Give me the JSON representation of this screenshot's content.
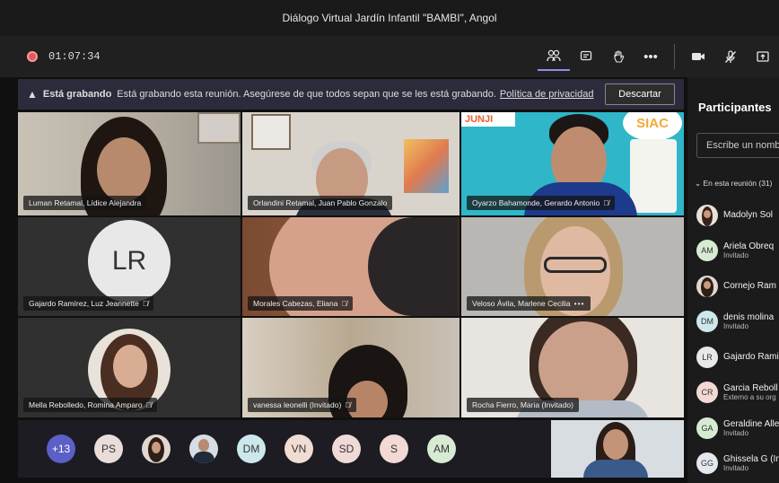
{
  "window": {
    "title": "Diálogo Virtual Jardín Infantil \"BAMBI\", Angol"
  },
  "toolbar": {
    "timer": "01:07:34",
    "icons": [
      "people-icon",
      "chat-icon",
      "raise-hand-icon",
      "more-icon",
      "camera-icon",
      "mic-off-icon",
      "share-icon"
    ]
  },
  "banner": {
    "bold": "Está grabando",
    "text": "Está grabando esta reunión. Asegúrese de que todos sepan que se les está grabando.",
    "link": "Política de privacidad",
    "button": "Descartar"
  },
  "tiles": [
    {
      "name": "Luman Retamal, Lídice Alejandra"
    },
    {
      "name": "Orlandini Retamal, Juan Pablo Gonzalo"
    },
    {
      "name": "Oyarzo Bahamonde, Gerardo Antonio",
      "sign_junji": "JUNJI",
      "sign_siac": "SIAC"
    },
    {
      "name": "Gajardo Ramírez, Luz Jeannette",
      "initials": "LR"
    },
    {
      "name": "Morales Cabezas, Eliana"
    },
    {
      "name": "Veloso Ávila, Marlene Cecilia"
    },
    {
      "name": "Mella Rebolledo, Romina Amparo"
    },
    {
      "name": "vanessa leonelli (Invitado)"
    },
    {
      "name": "Rocha Fierro, Maria (Invitado)"
    }
  ],
  "bottom_bar": {
    "more_count": "+13",
    "avatars": [
      "PS",
      "DM",
      "VN",
      "SD",
      "S",
      "AM"
    ]
  },
  "participants_panel": {
    "title": "Participantes",
    "search_placeholder": "Escribe un nomb",
    "section": "En esta reunión (31)",
    "list": [
      {
        "name": "Madolyn Sol",
        "sub": ""
      },
      {
        "name": "Ariela Obreq",
        "sub": "Invitado",
        "initials": "AM"
      },
      {
        "name": "Cornejo Ram",
        "sub": ""
      },
      {
        "name": "denis molina",
        "sub": "Invitado",
        "initials": "DM"
      },
      {
        "name": "Gajardo Rami",
        "sub": "",
        "initials": "LR"
      },
      {
        "name": "Garcia Reboll",
        "sub": "Externo a su org",
        "initials": "CR"
      },
      {
        "name": "Geraldine Alle",
        "sub": "Invitado",
        "initials": "GA"
      },
      {
        "name": "Ghissela G (In",
        "sub": "Invitado",
        "initials": "GG"
      }
    ]
  },
  "colors": {
    "accent": "#8b8df0",
    "more_badge": "#5b5fc7",
    "banner_bg": "#2b2b3c"
  }
}
